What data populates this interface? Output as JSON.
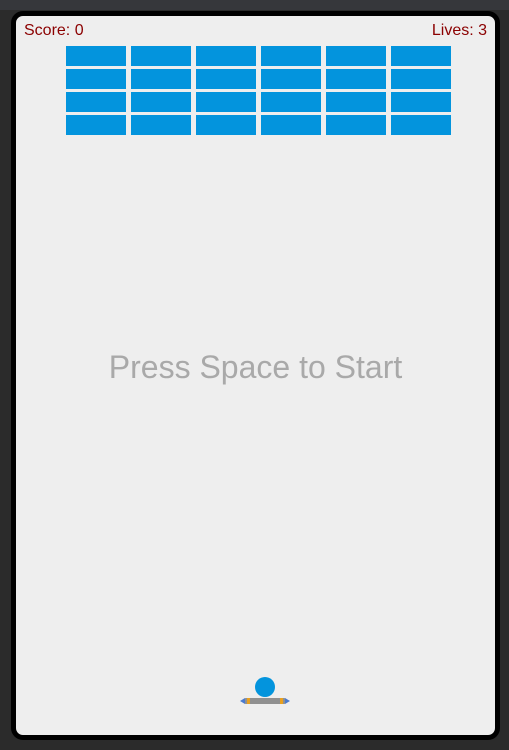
{
  "hud": {
    "score_label": "Score: 0",
    "lives_label": "Lives: 3"
  },
  "game": {
    "score": 0,
    "lives": 3,
    "brick_rows": 4,
    "brick_columns": 6,
    "message": "Press Space to Start"
  },
  "colors": {
    "brick": "#0394dd",
    "ball": "#0394dd",
    "hud_text": "#8b0000",
    "message_text": "#a9a9a9",
    "background": "#eeeeee",
    "frame": "#000000"
  },
  "icons": {
    "ball": "ball-icon",
    "paddle": "paddle-icon"
  }
}
